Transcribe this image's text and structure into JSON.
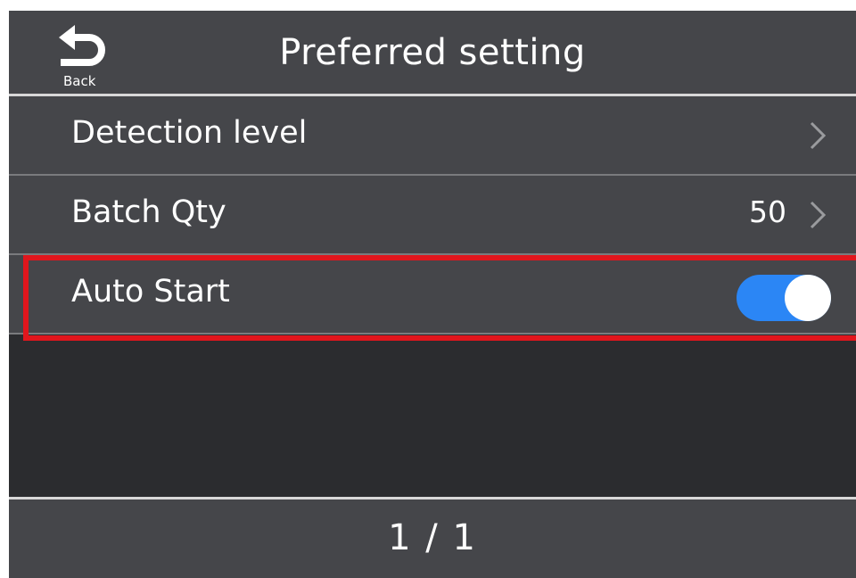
{
  "header": {
    "back_label": "Back",
    "title": "Preferred setting"
  },
  "settings": [
    {
      "label": "Detection level",
      "value": "",
      "control": "chevron"
    },
    {
      "label": "Batch Qty",
      "value": "50",
      "control": "chevron"
    },
    {
      "label": "Auto Start",
      "value": "",
      "control": "toggle",
      "toggle_on": true
    }
  ],
  "footer": {
    "page_indicator": "1 / 1"
  },
  "colors": {
    "bar_background": "#45464a",
    "content_background": "#2b2c2f",
    "toggle_on": "#2b86f5",
    "highlight_border": "#e0161d"
  }
}
